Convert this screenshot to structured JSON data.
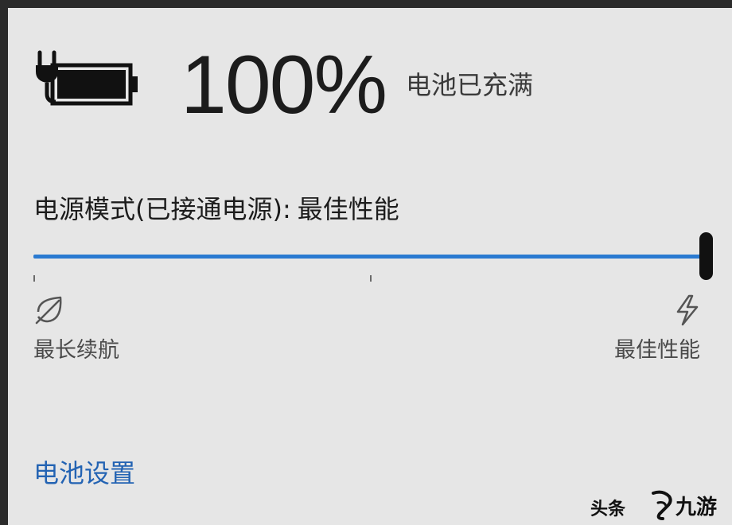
{
  "battery": {
    "percent": "100%",
    "status": "电池已充满",
    "charge_level": 1.0
  },
  "power_mode": {
    "label": "电源模式(已接通电源):",
    "value": "最佳性能",
    "slider": {
      "position": 1.0,
      "tick_positions": [
        0,
        0.5
      ],
      "left_label": "最长续航",
      "right_label": "最佳性能",
      "left_icon": "leaf-icon",
      "right_icon": "lightning-icon"
    }
  },
  "links": {
    "battery_settings": "电池设置"
  },
  "watermark": {
    "text": "头条",
    "logo_text": "九游"
  },
  "colors": {
    "background": "#e6e6e6",
    "accent": "#2a7ad1",
    "link": "#2363b3",
    "thumb": "#111111"
  }
}
